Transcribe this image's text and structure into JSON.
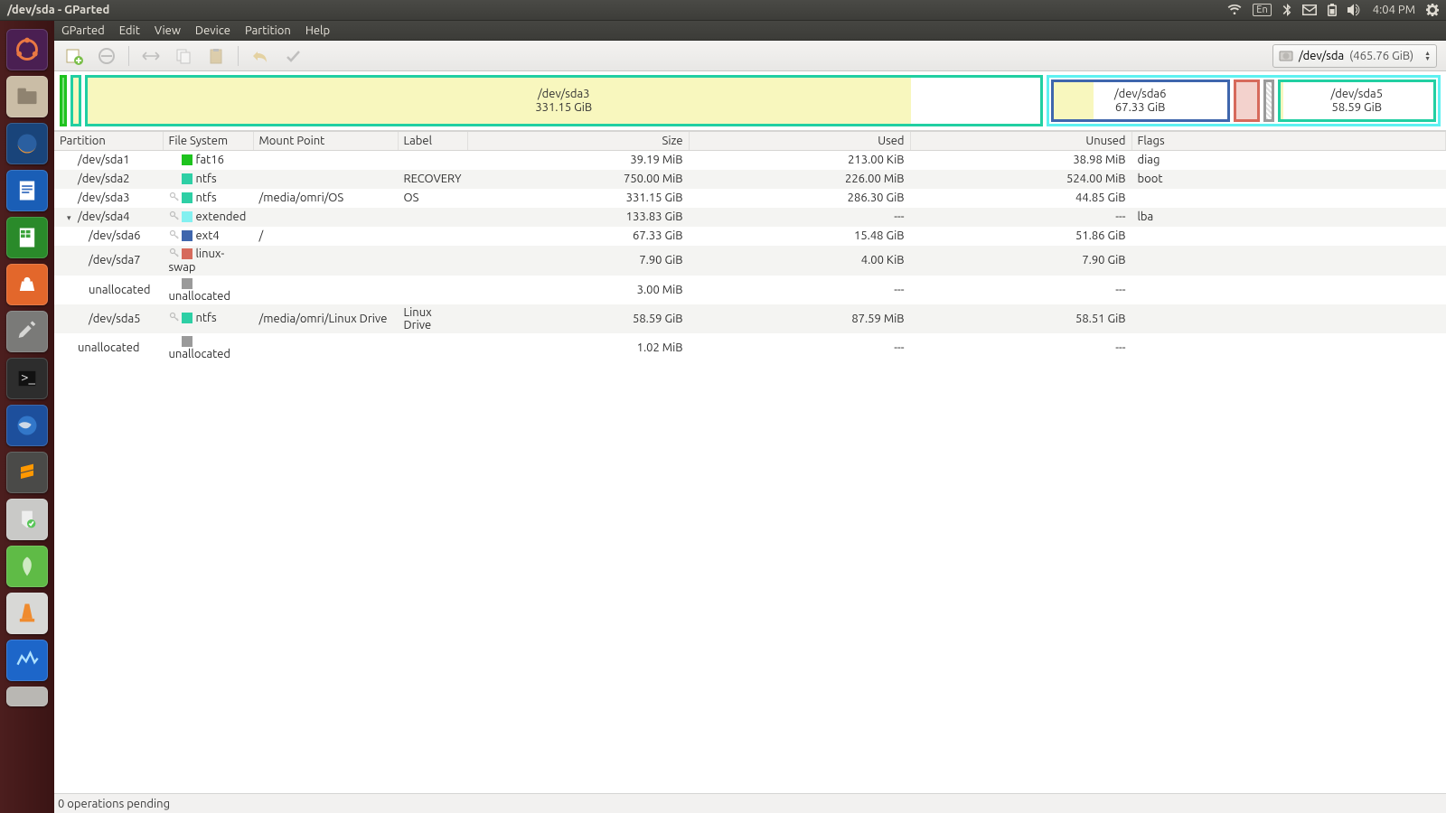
{
  "window_title": "/dev/sda - GParted",
  "clock": "4:04 PM",
  "kbd_indicator": "En",
  "menu": {
    "gparted": "GParted",
    "edit": "Edit",
    "view": "View",
    "device": "Device",
    "partition": "Partition",
    "help": "Help"
  },
  "device_selector": {
    "device": "/dev/sda",
    "size": "(465.76 GiB)"
  },
  "columns": {
    "partition": "Partition",
    "filesystem": "File System",
    "mount": "Mount Point",
    "label": "Label",
    "size": "Size",
    "used": "Used",
    "unused": "Unused",
    "flags": "Flags"
  },
  "diskmap": {
    "seg_sda3": {
      "label": "/dev/sda3",
      "sub": "331.15 GiB"
    },
    "seg_sda6": {
      "label": "/dev/sda6",
      "sub": "67.33 GiB"
    },
    "seg_sda5": {
      "label": "/dev/sda5",
      "sub": "58.59 GiB"
    }
  },
  "rows": [
    {
      "indent": 0,
      "arrow": "",
      "key": false,
      "partition": "/dev/sda1",
      "fs_color": "#1ec31e",
      "fs": "fat16",
      "mount": "",
      "label": "",
      "size": "39.19 MiB",
      "used": "213.00 KiB",
      "unused": "38.98 MiB",
      "flags": "diag"
    },
    {
      "indent": 0,
      "arrow": "",
      "key": false,
      "partition": "/dev/sda2",
      "fs_color": "#2ecfa5",
      "fs": "ntfs",
      "mount": "",
      "label": "RECOVERY",
      "size": "750.00 MiB",
      "used": "226.00 MiB",
      "unused": "524.00 MiB",
      "flags": "boot"
    },
    {
      "indent": 0,
      "arrow": "",
      "key": true,
      "partition": "/dev/sda3",
      "fs_color": "#2ecfa5",
      "fs": "ntfs",
      "mount": "/media/omri/OS",
      "label": "OS",
      "size": "331.15 GiB",
      "used": "286.30 GiB",
      "unused": "44.85 GiB",
      "flags": ""
    },
    {
      "indent": 0,
      "arrow": "▾",
      "key": true,
      "partition": "/dev/sda4",
      "fs_color": "#83f0f0",
      "fs": "extended",
      "mount": "",
      "label": "",
      "size": "133.83 GiB",
      "used": "---",
      "unused": "---",
      "flags": "lba"
    },
    {
      "indent": 1,
      "arrow": "",
      "key": true,
      "partition": "/dev/sda6",
      "fs_color": "#3f66ad",
      "fs": "ext4",
      "mount": "/",
      "label": "",
      "size": "67.33 GiB",
      "used": "15.48 GiB",
      "unused": "51.86 GiB",
      "flags": ""
    },
    {
      "indent": 1,
      "arrow": "",
      "key": true,
      "partition": "/dev/sda7",
      "fs_color": "#d66a5c",
      "fs": "linux-swap",
      "mount": "",
      "label": "",
      "size": "7.90 GiB",
      "used": "4.00 KiB",
      "unused": "7.90 GiB",
      "flags": ""
    },
    {
      "indent": 1,
      "arrow": "",
      "key": false,
      "partition": "unallocated",
      "fs_color": "#9a9a9a",
      "fs": "unallocated",
      "mount": "",
      "label": "",
      "size": "3.00 MiB",
      "used": "---",
      "unused": "---",
      "flags": ""
    },
    {
      "indent": 1,
      "arrow": "",
      "key": true,
      "partition": "/dev/sda5",
      "fs_color": "#2ecfa5",
      "fs": "ntfs",
      "mount": "/media/omri/Linux Drive",
      "label": "Linux Drive",
      "size": "58.59 GiB",
      "used": "87.59 MiB",
      "unused": "58.51 GiB",
      "flags": ""
    },
    {
      "indent": 0,
      "arrow": "",
      "key": false,
      "partition": "unallocated",
      "fs_color": "#9a9a9a",
      "fs": "unallocated",
      "mount": "",
      "label": "",
      "size": "1.02 MiB",
      "used": "---",
      "unused": "---",
      "flags": ""
    }
  ],
  "statusbar": "0 operations pending"
}
